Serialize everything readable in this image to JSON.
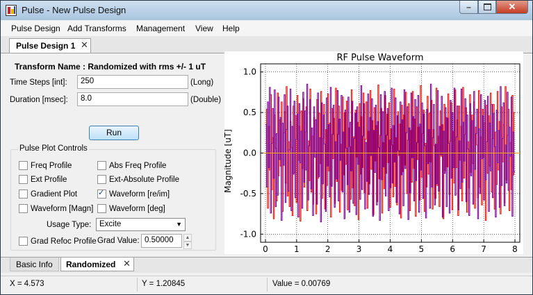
{
  "window": {
    "title": "Pulse - New Pulse Design"
  },
  "menu": [
    "Pulse Design",
    "Add Transforms",
    "Management",
    "View",
    "Help"
  ],
  "doc_tab": {
    "label": "Pulse Design 1",
    "close": "✕"
  },
  "transform": {
    "name": "Transform Name : Randomized with rms +/- 1 uT",
    "time_steps": {
      "label": "Time Steps [int]:",
      "value": "250",
      "unit": "(Long)"
    },
    "duration": {
      "label": "Duration [msec]:",
      "value": "8.0",
      "unit": "(Double)"
    },
    "run_label": "Run"
  },
  "plot_controls": {
    "title": "Pulse Plot Controls",
    "checkboxes": [
      {
        "label": "Freq Profile",
        "checked": false
      },
      {
        "label": "Abs Freq Profile",
        "checked": false
      },
      {
        "label": "Ext Profile",
        "checked": false
      },
      {
        "label": "Ext-Absolute Profile",
        "checked": false
      },
      {
        "label": "Gradient Plot",
        "checked": false
      },
      {
        "label": "Waveform [re/im]",
        "checked": true
      },
      {
        "label": "Waveform [Magn]",
        "checked": false
      },
      {
        "label": "Waveform [deg]",
        "checked": false
      }
    ],
    "usage_label": "Usage Type:",
    "usage_value": "Excite",
    "grad_refoc_label": "Grad Refoc Profile",
    "grad_value_label": "Grad Value:",
    "grad_value": "0.50000"
  },
  "bottom_tabs": {
    "basic": "Basic Info",
    "randomized": "Randomized",
    "close": "✕"
  },
  "status": {
    "x": "X = 4.573",
    "y": "Y = 1.20845",
    "value": "Value = 0.00769"
  },
  "colors": {
    "real": "#ee1100",
    "imag": "#7a0099",
    "zero_line": "#ffaa00",
    "accent": "#3c7fb1"
  },
  "chart_data": {
    "type": "line",
    "title": "RF Pulse Waveform",
    "ylabel": "Magnitude [uT]",
    "xlabel": "",
    "xlim": [
      0,
      8
    ],
    "ylim": [
      -1.1,
      1.1
    ],
    "xticks": [
      "0",
      "1",
      "2",
      "3",
      "4",
      "5",
      "6",
      "7",
      "8"
    ],
    "yticks": [
      "1.0",
      "0.5",
      "0.0",
      "-0.5",
      "-1.0"
    ],
    "ytick_values": [
      1.0,
      0.5,
      0.0,
      -0.5,
      -1.0
    ],
    "grid": true,
    "zero_line": 0,
    "series": [
      {
        "values": [
          0.35,
          -0.42,
          0.63,
          -0.18,
          0.81,
          -0.74,
          0.12,
          0.55,
          -0.31,
          0.78,
          -0.66,
          0.24,
          -0.52,
          0.69,
          -0.08,
          0.44,
          -0.83,
          0.37,
          -0.15,
          0.72,
          -0.61,
          0.29,
          0.58,
          -0.47,
          0.04,
          0.79,
          -0.71,
          0.33,
          -0.26,
          0.64,
          -0.55,
          0.17,
          0.48,
          -0.79,
          0.61,
          -0.12,
          0.27,
          -0.68,
          0.75,
          -0.36,
          0.52,
          -0.21,
          0.85,
          -0.58,
          0.09,
          0.66,
          -0.44,
          0.31,
          -0.77,
          0.57,
          -0.05,
          0.41,
          -0.63,
          0.74,
          -0.29,
          0.19,
          -0.85,
          0.62,
          -0.38,
          0.47,
          0.11,
          -0.72,
          0.68,
          -0.16,
          0.35,
          -0.54,
          0.81,
          -0.41,
          0.23,
          0.59,
          -0.67,
          0.14,
          -0.32,
          0.77,
          -0.59,
          0.42,
          -0.09,
          0.71,
          -0.48,
          0.26,
          -0.81,
          0.53,
          0.06,
          -0.39,
          0.69,
          -0.73,
          0.38,
          -0.22,
          0.64,
          -0.62,
          0.18,
          0.49,
          -0.76,
          0.57,
          -0.14,
          0.32,
          -0.57,
          0.83,
          -0.45,
          0.21,
          0.61,
          -0.69,
          0.13,
          -0.35,
          0.73,
          -0.51,
          0.44,
          -0.03,
          0.67,
          -0.78,
          0.28,
          -0.24,
          0.59,
          -0.64,
          0.39,
          0.07,
          -0.83,
          0.72,
          -0.33,
          0.51,
          -0.17,
          0.76,
          -0.53,
          0.22,
          0.55,
          -0.71,
          0.16,
          -0.43,
          0.8,
          -0.37,
          0.34,
          -0.11,
          0.68,
          -0.61,
          0.46,
          0.03,
          -0.75,
          0.63,
          -0.27,
          0.41,
          -0.65,
          0.78,
          -0.19,
          0.25,
          0.57,
          -0.82,
          0.31,
          -0.49,
          0.74,
          -0.06,
          0.45,
          -0.59,
          0.66,
          -0.34,
          0.13,
          0.71,
          -0.73,
          0.36,
          -0.21,
          0.62,
          -0.56,
          0.48,
          0.09,
          -0.8,
          0.54,
          -0.13,
          0.29,
          -0.68,
          0.85,
          -0.42,
          0.19,
          0.6,
          -0.64,
          0.11,
          -0.38,
          0.77,
          -0.47,
          0.33,
          -0.02,
          0.7,
          -0.79,
          0.27,
          -0.25,
          0.56,
          -0.66,
          0.43,
          0.12,
          -0.74,
          0.65,
          -0.31,
          0.5,
          -0.18,
          0.8,
          -0.52,
          0.2,
          0.58,
          -0.7,
          0.15,
          -0.44,
          0.79,
          -0.36,
          0.38,
          -0.1,
          0.67,
          -0.6,
          0.47,
          0.05,
          -0.77,
          0.61,
          -0.28,
          0.4,
          -0.63,
          0.76,
          -0.2,
          0.24,
          0.54,
          -0.81,
          0.3,
          -0.5,
          0.72,
          -0.07,
          0.46,
          -0.58,
          0.65,
          -0.33,
          0.14,
          0.7,
          -0.72,
          0.37,
          -0.22,
          0.6,
          -0.55,
          0.49,
          0.08,
          -0.79,
          0.53,
          -0.12,
          0.28,
          -0.67,
          0.82,
          -0.4,
          0.18,
          0.62,
          -0.65,
          0.1,
          -0.37,
          0.75,
          -0.46,
          0.32,
          -0.04,
          0.69,
          -0.78,
          0.26,
          -0.23
        ]
      },
      {
        "values": [
          0.12,
          0.54,
          -0.68,
          0.33,
          -0.21,
          0.72,
          -0.45,
          0.19,
          -0.81,
          0.47,
          0.06,
          -0.59,
          0.74,
          -0.28,
          0.41,
          -0.16,
          0.63,
          -0.72,
          0.25,
          0.51,
          -0.37,
          0.82,
          -0.53,
          0.14,
          -0.66,
          0.39,
          0.07,
          -0.77,
          0.58,
          -0.24,
          0.46,
          -0.61,
          0.71,
          -0.09,
          0.33,
          -0.84,
          0.52,
          -0.19,
          0.67,
          -0.42,
          0.26,
          0.57,
          -0.71,
          0.15,
          -0.34,
          0.79,
          -0.48,
          0.21,
          -0.63,
          0.44,
          0.02,
          -0.75,
          0.66,
          -0.31,
          0.49,
          -0.13,
          0.76,
          -0.56,
          0.18,
          0.6,
          -0.69,
          0.29,
          -0.4,
          0.73,
          -0.22,
          0.37,
          -0.79,
          0.55,
          -0.07,
          0.43,
          -0.62,
          0.8,
          -0.35,
          0.23,
          0.58,
          -0.73,
          0.11,
          -0.46,
          0.69,
          -0.27,
          0.5,
          -0.14,
          0.64,
          -0.7,
          0.31,
          0.08,
          -0.57,
          0.78,
          -0.43,
          0.2,
          -0.65,
          0.53,
          -0.05,
          0.38,
          -0.82,
          0.61,
          -0.26,
          0.45,
          -0.18,
          0.74,
          -0.49,
          0.17,
          0.63,
          -0.68,
          0.27,
          -0.38,
          0.77,
          -0.2,
          0.4,
          -0.76,
          0.56,
          -0.1,
          0.34,
          -0.6,
          0.84,
          -0.32,
          0.22,
          0.55,
          -0.74,
          0.13,
          -0.44,
          0.71,
          -0.25,
          0.48,
          -0.12,
          0.62,
          -0.67,
          0.3,
          0.1,
          -0.54,
          0.79,
          -0.41,
          0.19,
          -0.64,
          0.51,
          -0.03,
          0.36,
          -0.8,
          0.59,
          -0.23,
          0.47,
          -0.15,
          0.75,
          -0.5,
          0.16,
          0.61,
          -0.71,
          0.28,
          -0.36,
          0.76,
          -0.19,
          0.42,
          -0.78,
          0.57,
          -0.08,
          0.32,
          -0.58,
          0.83,
          -0.3,
          0.24,
          0.53,
          -0.72,
          0.12,
          -0.42,
          0.7,
          -0.26,
          0.49,
          -0.11,
          0.65,
          -0.69,
          0.29,
          0.09,
          -0.56,
          0.8,
          -0.4,
          0.21,
          -0.66,
          0.52,
          -0.04,
          0.35,
          -0.81,
          0.6,
          -0.22,
          0.44,
          -0.17,
          0.73,
          -0.51,
          0.15,
          0.62,
          -0.7,
          0.27,
          -0.37,
          0.78,
          -0.18,
          0.41,
          -0.77,
          0.58,
          -0.09,
          0.33,
          -0.59,
          0.81,
          -0.31,
          0.23,
          0.56,
          -0.73,
          0.14,
          -0.43,
          0.72,
          -0.24,
          0.47,
          -0.13,
          0.63,
          -0.68,
          0.32,
          0.1,
          -0.55,
          0.77,
          -0.42,
          0.2,
          -0.64,
          0.54,
          -0.06,
          0.37,
          -0.83,
          0.59,
          -0.25,
          0.46,
          -0.16,
          0.74,
          -0.48,
          0.18,
          0.6,
          -0.69,
          0.26,
          -0.39,
          0.76,
          -0.21,
          0.39,
          -0.75,
          0.57,
          -0.11,
          0.35,
          -0.61,
          0.82,
          -0.33,
          0.22,
          0.54,
          -0.71,
          0.13,
          -0.45,
          0.71,
          -0.27,
          0.5
        ]
      }
    ]
  }
}
